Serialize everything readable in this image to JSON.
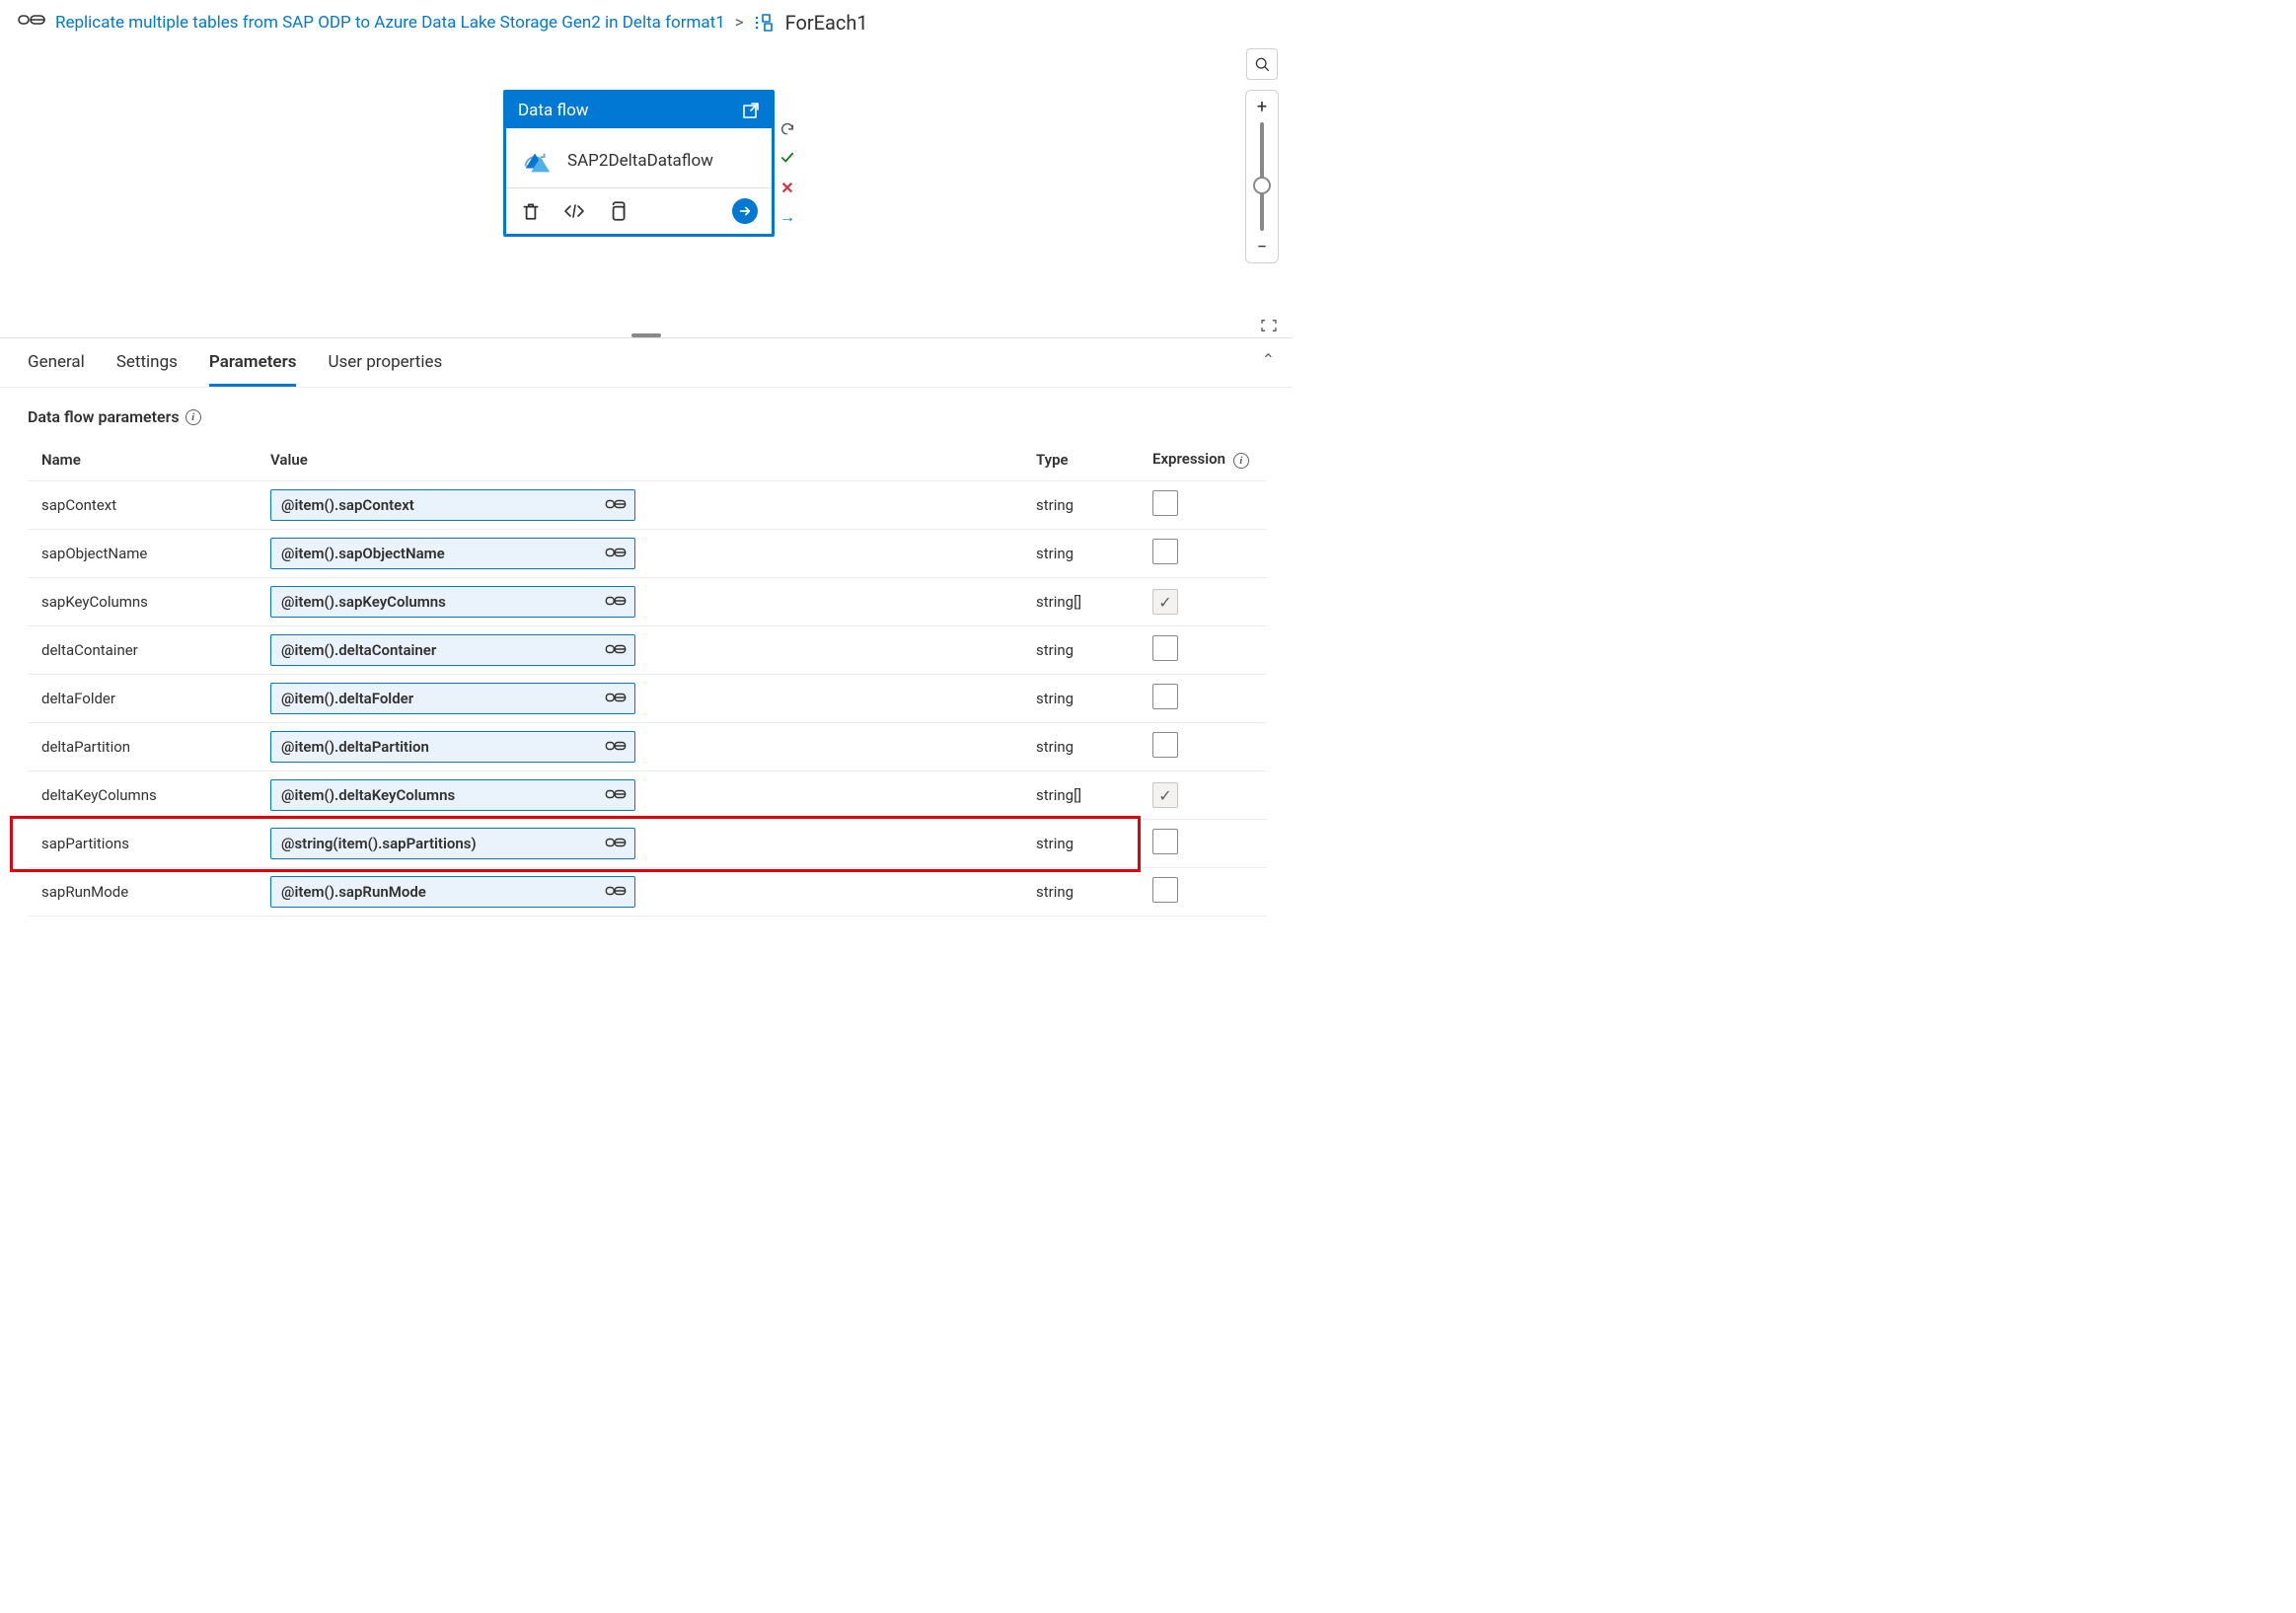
{
  "breadcrumb": {
    "root_label": "Replicate multiple tables from SAP ODP to Azure Data Lake Storage Gen2 in Delta format1",
    "current_label": "ForEach1"
  },
  "activity": {
    "header": "Data flow",
    "name": "SAP2DeltaDataflow"
  },
  "tabs": {
    "general": "General",
    "settings": "Settings",
    "parameters": "Parameters",
    "user_properties": "User properties"
  },
  "section_heading": "Data flow parameters",
  "columns": {
    "name": "Name",
    "value": "Value",
    "type": "Type",
    "expression": "Expression"
  },
  "rows": [
    {
      "name": "sapContext",
      "value": "@item().sapContext",
      "type": "string",
      "checked": false,
      "highlight": false
    },
    {
      "name": "sapObjectName",
      "value": "@item().sapObjectName",
      "type": "string",
      "checked": false,
      "highlight": false
    },
    {
      "name": "sapKeyColumns",
      "value": "@item().sapKeyColumns",
      "type": "string[]",
      "checked": true,
      "highlight": false
    },
    {
      "name": "deltaContainer",
      "value": "@item().deltaContainer",
      "type": "string",
      "checked": false,
      "highlight": false
    },
    {
      "name": "deltaFolder",
      "value": "@item().deltaFolder",
      "type": "string",
      "checked": false,
      "highlight": false
    },
    {
      "name": "deltaPartition",
      "value": "@item().deltaPartition",
      "type": "string",
      "checked": false,
      "highlight": false
    },
    {
      "name": "deltaKeyColumns",
      "value": "@item().deltaKeyColumns",
      "type": "string[]",
      "checked": true,
      "highlight": false
    },
    {
      "name": "sapPartitions",
      "value": "@string(item().sapPartitions)",
      "type": "string",
      "checked": false,
      "highlight": true
    },
    {
      "name": "sapRunMode",
      "value": "@item().sapRunMode",
      "type": "string",
      "checked": false,
      "highlight": false
    }
  ]
}
